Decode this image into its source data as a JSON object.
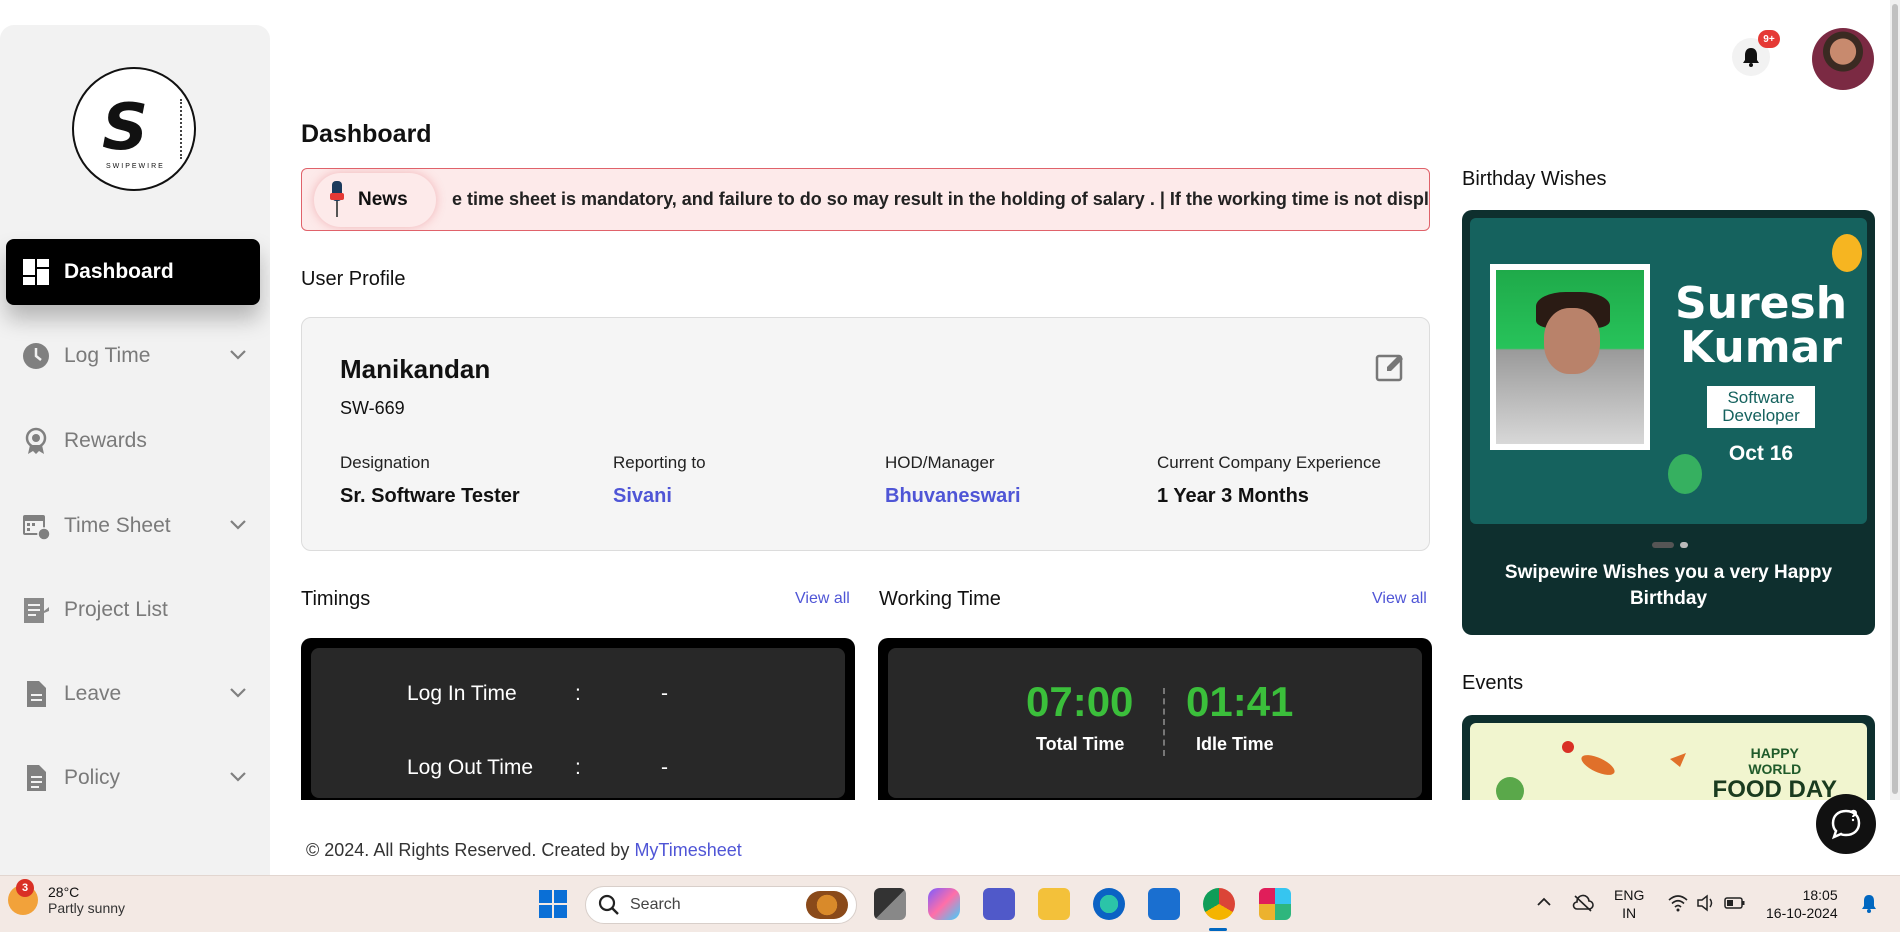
{
  "brand": {
    "logo_letter": "S",
    "logo_text": "SWIPEWIRE"
  },
  "sidebar": {
    "items": [
      {
        "label": "Dashboard",
        "icon": "dashboard-icon",
        "active": true
      },
      {
        "label": "Log Time",
        "icon": "clock-icon",
        "expandable": true
      },
      {
        "label": "Rewards",
        "icon": "award-icon"
      },
      {
        "label": "Time Sheet",
        "icon": "calendar-clock-icon",
        "expandable": true
      },
      {
        "label": "Project List",
        "icon": "project-doc-icon"
      },
      {
        "label": "Leave",
        "icon": "file-icon",
        "expandable": true
      },
      {
        "label": "Policy",
        "icon": "policy-doc-icon",
        "expandable": true
      }
    ]
  },
  "header": {
    "notification_badge": "9+"
  },
  "page": {
    "title": "Dashboard"
  },
  "news": {
    "label": "News",
    "text": "e time sheet is mandatory, and failure to do so may result in the holding of salary . | If the working time is not displayin"
  },
  "profile": {
    "section_title": "User Profile",
    "name": "Manikandan",
    "employee_id": "SW-669",
    "fields": [
      {
        "label": "Designation",
        "value": "Sr. Software Tester"
      },
      {
        "label": "Reporting to",
        "value": "Sivani"
      },
      {
        "label": "HOD/Manager",
        "value": "Bhuvaneswari"
      },
      {
        "label": "Current Company Experience",
        "value": "1 Year 3 Months"
      }
    ]
  },
  "timings": {
    "title": "Timings",
    "view_all": "View all",
    "rows": [
      {
        "label": "Log In Time",
        "sep": ":",
        "value": "-"
      },
      {
        "label": "Log Out Time",
        "sep": ":",
        "value": "-"
      }
    ]
  },
  "working_time": {
    "title": "Working Time",
    "view_all": "View all",
    "total_value": "07:00",
    "total_label": "Total Time",
    "idle_value": "01:41",
    "idle_label": "Idle Time"
  },
  "birthday": {
    "title": "Birthday Wishes",
    "name": "Suresh Kumar",
    "role": "Software Developer",
    "date": "Oct 16",
    "message": "Swipewire Wishes you a very Happy Birthday"
  },
  "events": {
    "title": "Events",
    "card_line1": "HAPPY",
    "card_line2": "WORLD",
    "card_line3": "FOOD DAY"
  },
  "footer": {
    "text": "© 2024. All Rights Reserved. Created by ",
    "link": "MyTimesheet"
  },
  "taskbar": {
    "weather_badge": "3",
    "temperature": "28°C",
    "condition": "Partly sunny",
    "search_placeholder": "Search",
    "language": "ENG",
    "region": "IN",
    "time": "18:05",
    "date": "16-10-2024"
  },
  "colors": {
    "accent_link": "#4f55d6",
    "timer_green": "#3bbf3b",
    "news_border": "#e0626a",
    "birthday_bg": "#15625e"
  }
}
